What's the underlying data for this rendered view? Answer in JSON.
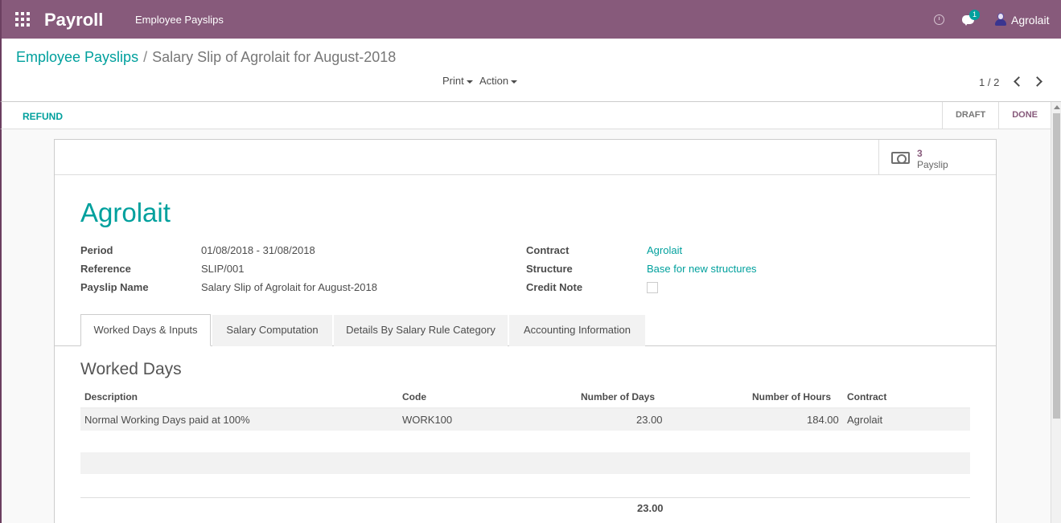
{
  "navbar": {
    "app_title": "Payroll",
    "menu_item": "Employee Payslips",
    "chat_badge": "1",
    "user_name": "Agrolait",
    "icons": [
      "apps-icon",
      "clock-icon",
      "chat-icon",
      "user-avatar-icon"
    ]
  },
  "control_panel": {
    "breadcrumb_parent": "Employee Payslips",
    "breadcrumb_separator": "/",
    "breadcrumb_current": "Salary Slip of Agrolait for August-2018",
    "print_label": "Print",
    "action_label": "Action",
    "pager_value": "1 / 2"
  },
  "statusbar": {
    "refund_label": "REFUND",
    "steps": [
      "DRAFT",
      "DONE"
    ],
    "current_step": "DONE"
  },
  "form": {
    "stat_button": {
      "value": "3",
      "label": "Payslip"
    },
    "title": "Agrolait",
    "left_fields": [
      {
        "label": "Period",
        "value": "01/08/2018 - 31/08/2018"
      },
      {
        "label": "Reference",
        "value": "SLIP/001"
      },
      {
        "label": "Payslip Name",
        "value": "Salary Slip of Agrolait for August-2018"
      }
    ],
    "right_fields": [
      {
        "label": "Contract",
        "value": "Agrolait"
      },
      {
        "label": "Structure",
        "value": "Base for new structures"
      },
      {
        "label": "Credit Note",
        "value": ""
      }
    ],
    "credit_note_checked": false,
    "tabs": [
      "Worked Days & Inputs",
      "Salary Computation",
      "Details By Salary Rule Category",
      "Accounting Information"
    ],
    "active_tab": "Worked Days & Inputs",
    "section_title": "Worked Days",
    "table": {
      "columns": [
        "Description",
        "Code",
        "Number of Days",
        "Number of Hours",
        "Contract"
      ],
      "rows": [
        [
          "Normal Working Days paid at 100%",
          "WORK100",
          "23.00",
          "184.00",
          "Agrolait"
        ]
      ],
      "total_days": "23.00"
    }
  },
  "colors": {
    "brand": "#875a7b",
    "accent": "#00a09d"
  }
}
